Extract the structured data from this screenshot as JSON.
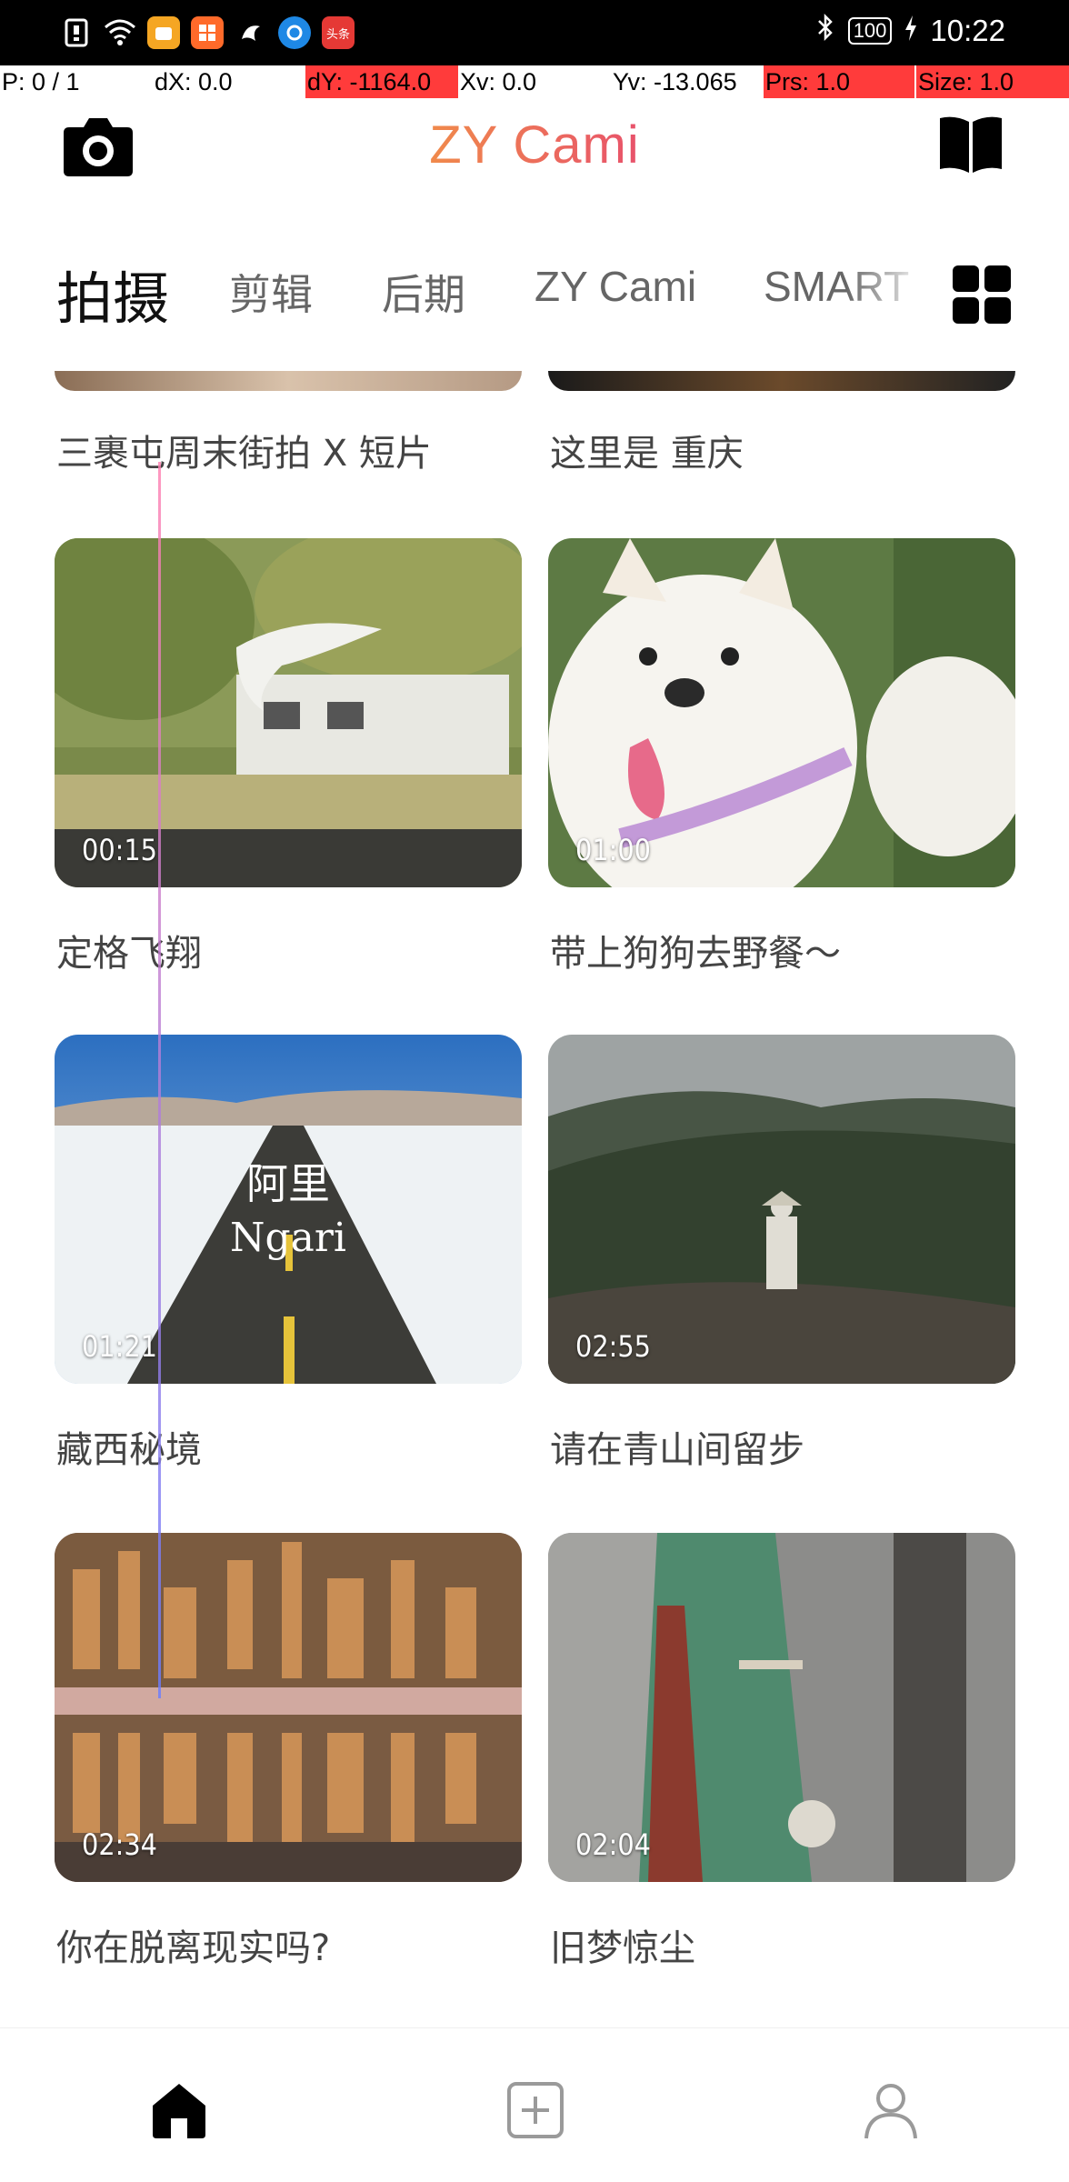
{
  "status_bar": {
    "time": "10:22",
    "battery": "100",
    "icons": [
      "sim-icon",
      "wifi-icon",
      "app-icon-1",
      "app-icon-2",
      "app-icon-3",
      "app-icon-4",
      "toutiao-icon"
    ],
    "toutiao_label": "头条"
  },
  "debug": {
    "p": "P: 0 / 1",
    "dx": "dX: 0.0",
    "dy": "dY: -1164.0",
    "xv": "Xv: 0.0",
    "yv": "Yv: -13.065",
    "prs": "Prs: 1.0",
    "size": "Size: 1.0"
  },
  "header": {
    "title": "ZY Cami",
    "title_color": "#f08a4b",
    "camera_icon": "camera-icon",
    "book_icon": "book-icon"
  },
  "tabs": [
    {
      "label": "拍摄",
      "active": true
    },
    {
      "label": "剪辑",
      "active": false
    },
    {
      "label": "后期",
      "active": false
    },
    {
      "label": "ZY Cami",
      "active": false
    },
    {
      "label": "SMART",
      "active": false
    }
  ],
  "videos": [
    {
      "title": "三裹屯周末街拍 X 短片",
      "duration": ""
    },
    {
      "title": "这里是 重庆",
      "duration": ""
    },
    {
      "title": "定格飞翔",
      "duration": "00:15"
    },
    {
      "title": "带上狗狗去野餐～",
      "duration": "01:00"
    },
    {
      "title": "藏西秘境",
      "duration": "01:21",
      "overlay_cn": "阿里",
      "overlay_en": "Ngari"
    },
    {
      "title": "请在青山间留步",
      "duration": "02:55"
    },
    {
      "title": "你在脱离现实吗?",
      "duration": "02:34"
    },
    {
      "title": "旧梦惊尘",
      "duration": "02:04"
    }
  ],
  "bottom_nav": {
    "home_icon": "home-icon",
    "add_icon": "add-icon",
    "profile_icon": "profile-icon"
  }
}
